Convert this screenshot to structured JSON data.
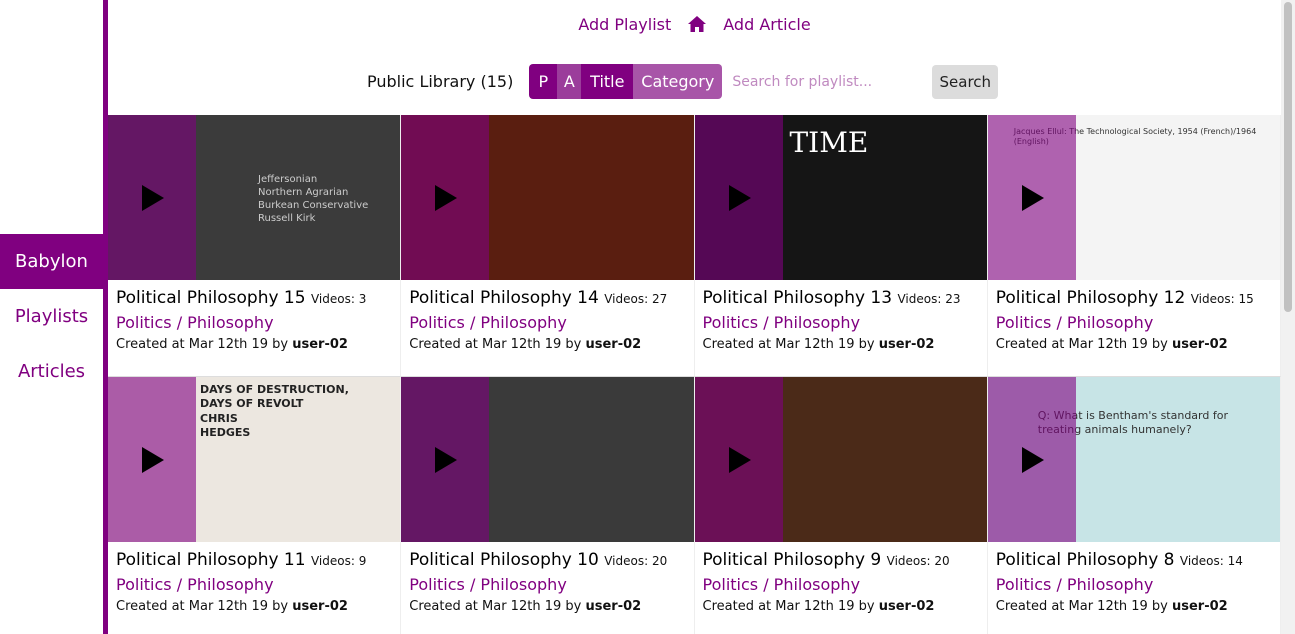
{
  "sidebar": {
    "items": [
      {
        "label": "Babylon",
        "active": true
      },
      {
        "label": "Playlists",
        "active": false
      },
      {
        "label": "Articles",
        "active": false
      }
    ]
  },
  "topnav": {
    "add_playlist": "Add Playlist",
    "home_icon": "home-icon",
    "add_article": "Add Article"
  },
  "search": {
    "library_label": "Public Library (15)",
    "seg_p": "P",
    "seg_a": "A",
    "seg_title": "Title",
    "seg_category": "Category",
    "placeholder": "Search for playlist...",
    "button": "Search"
  },
  "colors": {
    "accent": "#800080"
  },
  "cards": [
    {
      "title": "Political Philosophy 15",
      "videos": "Videos: 3",
      "category": "Politics / Philosophy",
      "created": "Created at Mar 12th 19 by",
      "user": "user-02",
      "thumb_bg": "#3b3b3b",
      "thumb_lines": [
        "Jeffersonian",
        "Northern Agrarian",
        "Burkean Conservative",
        "Russell Kirk"
      ]
    },
    {
      "title": "Political Philosophy 14",
      "videos": "Videos: 27",
      "category": "Politics / Philosophy",
      "created": "Created at Mar 12th 19 by",
      "user": "user-02",
      "thumb_bg": "#5a1e10",
      "thumb_lines": []
    },
    {
      "title": "Political Philosophy 13",
      "videos": "Videos: 23",
      "category": "Politics / Philosophy",
      "created": "Created at Mar 12th 19 by",
      "user": "user-02",
      "thumb_bg": "#151515",
      "thumb_lines": [
        "TIME"
      ]
    },
    {
      "title": "Political Philosophy 12",
      "videos": "Videos: 15",
      "category": "Politics / Philosophy",
      "created": "Created at Mar 12th 19 by",
      "user": "user-02",
      "thumb_bg": "#f4f4f4",
      "thumb_lines": [
        "Jacques Ellul: The Technological Society, 1954 (French)/1964 (English)"
      ]
    },
    {
      "title": "Political Philosophy 11",
      "videos": "Videos: 9",
      "category": "Politics / Philosophy",
      "created": "Created at Mar 12th 19 by",
      "user": "user-02",
      "thumb_bg": "#ece7e0",
      "thumb_lines": [
        "DAYS OF DESTRUCTION,",
        "DAYS OF REVOLT",
        "CHRIS",
        "HEDGES"
      ]
    },
    {
      "title": "Political Philosophy 10",
      "videos": "Videos: 20",
      "category": "Politics / Philosophy",
      "created": "Created at Mar 12th 19 by",
      "user": "user-02",
      "thumb_bg": "#3a3a3a",
      "thumb_lines": []
    },
    {
      "title": "Political Philosophy 9",
      "videos": "Videos: 20",
      "category": "Politics / Philosophy",
      "created": "Created at Mar 12th 19 by",
      "user": "user-02",
      "thumb_bg": "#4b2a18",
      "thumb_lines": []
    },
    {
      "title": "Political Philosophy 8",
      "videos": "Videos: 14",
      "category": "Politics / Philosophy",
      "created": "Created at Mar 12th 19 by",
      "user": "user-02",
      "thumb_bg": "#c7e4e6",
      "thumb_lines": [
        "Q: What is Bentham's standard for",
        "treating animals humanely?"
      ]
    }
  ]
}
